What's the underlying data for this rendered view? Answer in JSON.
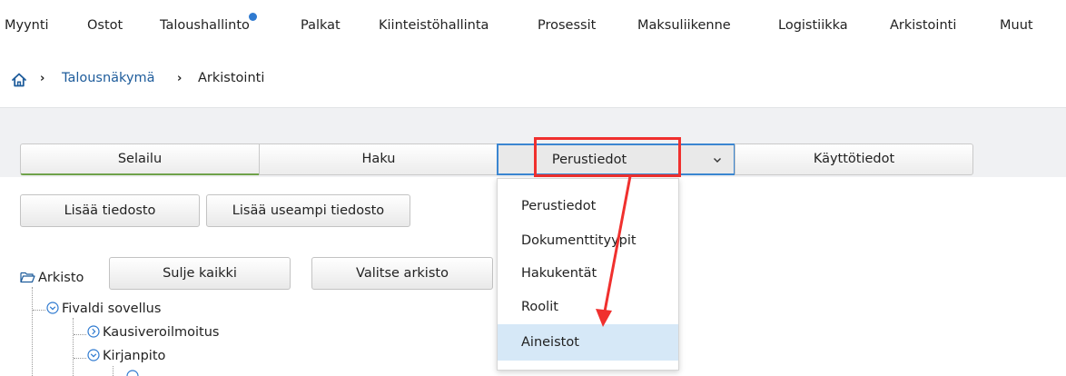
{
  "nav": {
    "items": [
      {
        "label": "Myynti"
      },
      {
        "label": "Ostot"
      },
      {
        "label": "Taloushallinto"
      },
      {
        "label": "Palkat"
      },
      {
        "label": "Kiinteistöhallinta"
      },
      {
        "label": "Prosessit"
      },
      {
        "label": "Maksuliikenne"
      },
      {
        "label": "Logistiikka"
      },
      {
        "label": "Arkistointi"
      },
      {
        "label": "Muut"
      }
    ]
  },
  "breadcrumb": {
    "link": "Talousnäkymä",
    "current": "Arkistointi"
  },
  "tabs": [
    {
      "label": "Selailu"
    },
    {
      "label": "Haku"
    },
    {
      "label": "Perustiedot"
    },
    {
      "label": "Käyttötiedot"
    }
  ],
  "buttons": {
    "add_file": "Lisää tiedosto",
    "add_multiple": "Lisää useampi tiedosto",
    "collapse_all": "Sulje kaikki",
    "select_archive": "Valitse arkisto"
  },
  "tree": {
    "root": "Arkisto",
    "nodes": [
      {
        "label": "Fivaldi sovellus",
        "state": "expanded"
      },
      {
        "label": "Kausiveroilmoitus",
        "state": "collapsed"
      },
      {
        "label": "Kirjanpito",
        "state": "expanded"
      }
    ]
  },
  "dropdown": {
    "items": [
      {
        "label": "Perustiedot"
      },
      {
        "label": "Dokumenttityypit"
      },
      {
        "label": "Hakukentät"
      },
      {
        "label": "Roolit"
      },
      {
        "label": "Aineistot"
      }
    ],
    "highlighted_index": 4
  },
  "colors": {
    "accent": "#3b86d1",
    "annotation": "#f0302e",
    "link": "#1e5c9b",
    "highlight": "#d6e8f7",
    "notification_dot": "#2f7ad0"
  }
}
